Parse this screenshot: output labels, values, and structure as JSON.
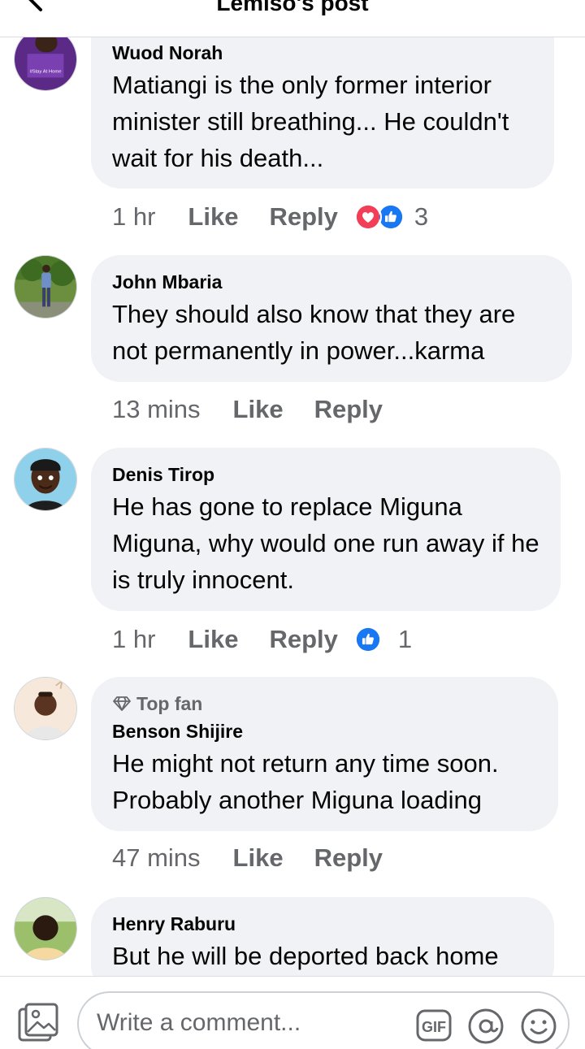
{
  "header": {
    "title": "Lemiso's post"
  },
  "comments": [
    {
      "author": "Wuod Norah",
      "text": "Matiangi is the only former interior minister still breathing... He couldn't wait for his death...",
      "time": "1 hr",
      "like": "Like",
      "reply": "Reply",
      "reactions": [
        "love",
        "like"
      ],
      "reaction_count": "3",
      "avatar_badge": "#Stay At Home"
    },
    {
      "author": "John Mbaria",
      "text": "They should also know that they are not permanently in power...karma",
      "time": "13 mins",
      "like": "Like",
      "reply": "Reply"
    },
    {
      "author": "Denis Tirop",
      "text": "He has gone to replace Miguna Miguna, why would one run away if he is truly innocent.",
      "time": "1 hr",
      "like": "Like",
      "reply": "Reply",
      "reactions": [
        "like"
      ],
      "reaction_count": "1"
    },
    {
      "badge": "Top fan",
      "author": "Benson Shijire",
      "text": "He might not return any time soon. Probably another Miguna loading",
      "time": "47 mins",
      "like": "Like",
      "reply": "Reply"
    },
    {
      "author": "Henry Raburu",
      "text": "But he will be deported back home"
    }
  ],
  "composer": {
    "placeholder": "Write a comment...",
    "gif_label": "GIF",
    "icons": [
      "photo-icon",
      "gif-icon",
      "at-icon",
      "emoji-icon"
    ]
  },
  "colors": {
    "like_blue": "#1877f2",
    "love_red": "#f33e58",
    "bubble": "#f0f2f5",
    "meta": "#65676b"
  }
}
